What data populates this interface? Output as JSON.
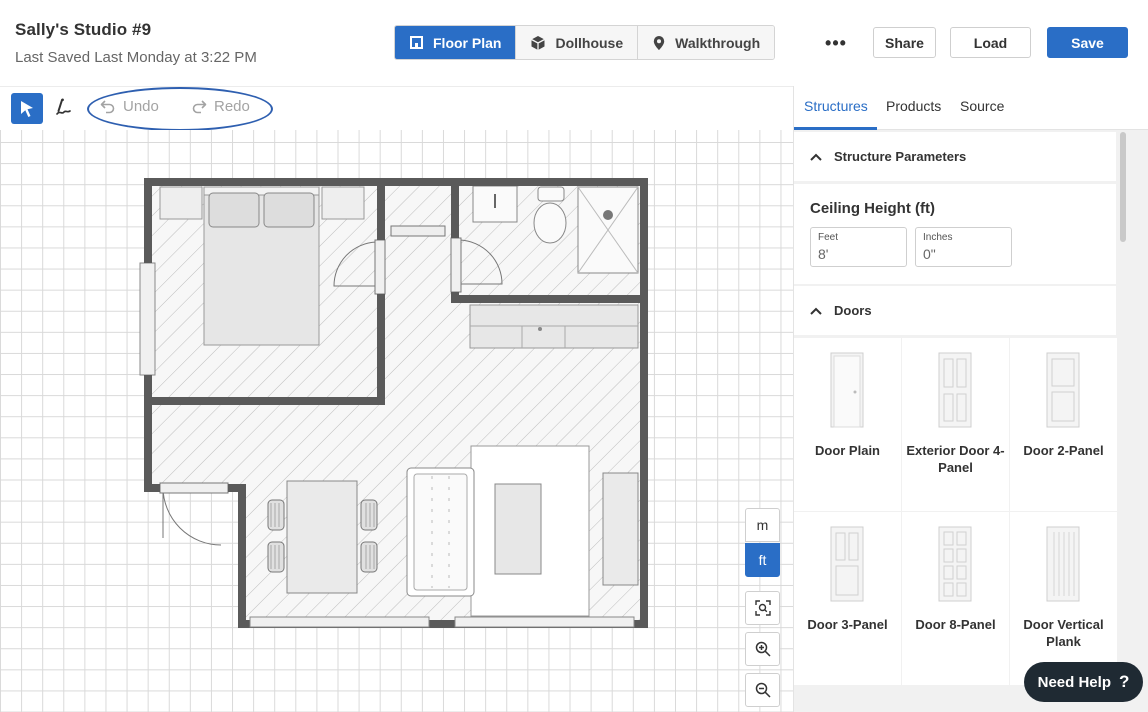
{
  "header": {
    "title": "Sally's Studio #9",
    "subtitle": "Last Saved Last Monday at 3:22 PM",
    "view_tabs": [
      {
        "label": "Floor Plan",
        "icon": "floorplan-icon",
        "active": true
      },
      {
        "label": "Dollhouse",
        "icon": "cube-icon",
        "active": false
      },
      {
        "label": "Walkthrough",
        "icon": "location-pin-icon",
        "active": false
      }
    ],
    "more_label": "•••",
    "share_label": "Share",
    "load_label": "Load",
    "save_label": "Save"
  },
  "toolbar": {
    "undo_label": "Undo",
    "redo_label": "Redo"
  },
  "canvas_controls": {
    "unit_m": "m",
    "unit_ft": "ft",
    "active_unit": "ft"
  },
  "panel": {
    "tabs": [
      {
        "label": "Structures",
        "active": true
      },
      {
        "label": "Products",
        "active": false
      },
      {
        "label": "Source",
        "active": false
      }
    ],
    "structure_section": "Structure Parameters",
    "ceiling": {
      "title": "Ceiling Height (ft)",
      "feet_label": "Feet",
      "feet_value": "8'",
      "inches_label": "Inches",
      "inches_value": "0\""
    },
    "doors_section": "Doors",
    "doors": [
      {
        "name": "Door Plain",
        "icon": "door-plain-icon"
      },
      {
        "name": "Exterior Door 4-Panel",
        "icon": "door-4-panel-icon"
      },
      {
        "name": "Door 2-Panel",
        "icon": "door-2-panel-icon"
      },
      {
        "name": "Door 3-Panel",
        "icon": "door-3-panel-icon"
      },
      {
        "name": "Door 8-Panel",
        "icon": "door-8-panel-icon"
      },
      {
        "name": "Door Vertical Plank",
        "icon": "door-vertical-plank-icon"
      }
    ]
  },
  "help": {
    "label": "Need Help",
    "icon": "?"
  },
  "colors": {
    "accent": "#2a6ec6",
    "wall": "#5a5a5a",
    "annotation": "#2e5fb0",
    "help_bg": "#1f2a33"
  }
}
